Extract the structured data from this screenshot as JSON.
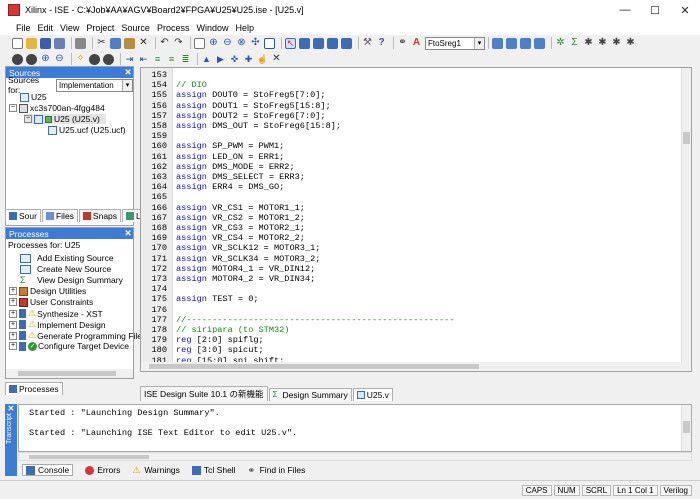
{
  "window": {
    "title": "Xilinx - ISE - C:¥Job¥AA¥AGV¥Board2¥FPGA¥U25¥U25.ise - [U25.v]",
    "minimize_glyph": "—",
    "maximize_glyph": "☐",
    "close_glyph": "✕"
  },
  "menu": [
    "File",
    "Edit",
    "View",
    "Project",
    "Source",
    "Process",
    "Window",
    "Help"
  ],
  "toolbar": {
    "search_value": "FtoSreg1",
    "row2_extra_icons": [
      "back-icon",
      "forward-icon",
      "zoom-in-icon",
      "zoom-out-icon",
      "help-icon"
    ]
  },
  "sources": {
    "header": "Sources",
    "close_glyph": "✕",
    "for_label": "Sources for:",
    "for_value": "Implementation",
    "tree": [
      {
        "label": "U25",
        "level": 0
      },
      {
        "label": "xc3s700an-4fgg484",
        "level": 0
      },
      {
        "label": "U25 (U25.v)",
        "level": 1
      },
      {
        "label": "U25.ucf (U25.ucf)",
        "level": 2
      }
    ],
    "tabs": [
      "Sources",
      "Files",
      "Snapshots",
      "Libraries"
    ],
    "tabs_visible": [
      "Sour",
      "Files",
      "Snaps",
      "Libra"
    ]
  },
  "processes": {
    "header": "Processes",
    "close_glyph": "✕",
    "for_label": "Processes for: U25",
    "items": [
      {
        "label": "Add Existing Source",
        "level": 1
      },
      {
        "label": "Create New Source",
        "level": 1
      },
      {
        "label": "View Design Summary",
        "level": 1
      },
      {
        "label": "Design Utilities",
        "level": 0
      },
      {
        "label": "User Constraints",
        "level": 0
      },
      {
        "label": "Synthesize - XST",
        "level": 0
      },
      {
        "label": "Implement Design",
        "level": 0
      },
      {
        "label": "Generate Programming File",
        "level": 0
      },
      {
        "label": "Configure Target Device",
        "level": 0
      }
    ],
    "tab": "Processes"
  },
  "editor": {
    "lines": [
      {
        "n": "153",
        "t": ""
      },
      {
        "n": "154",
        "t": "// DIO",
        "c": "cm"
      },
      {
        "n": "155",
        "t": "assign DOUT0 = StoFreg5[7:0];"
      },
      {
        "n": "156",
        "t": "assign DOUT1 = StoFreg5[15:8];"
      },
      {
        "n": "157",
        "t": "assign DOUT2 = StoFreg6[7:0];"
      },
      {
        "n": "158",
        "t": "assign DMS_OUT = StoFreg6[15:8];"
      },
      {
        "n": "159",
        "t": ""
      },
      {
        "n": "160",
        "t": "assign SP_PWM = PWM1;"
      },
      {
        "n": "161",
        "t": "assign LED_ON = ERR1;"
      },
      {
        "n": "162",
        "t": "assign DMS_MODE = ERR2;"
      },
      {
        "n": "163",
        "t": "assign DMS_SELECT = ERR3;"
      },
      {
        "n": "164",
        "t": "assign ERR4 = DMS_GO;"
      },
      {
        "n": "165",
        "t": ""
      },
      {
        "n": "166",
        "t": "assign VR_CS1 = MOTOR1_1;"
      },
      {
        "n": "167",
        "t": "assign VR_CS2 = MOTOR1_2;"
      },
      {
        "n": "168",
        "t": "assign VR_CS3 = MOTOR2_1;"
      },
      {
        "n": "169",
        "t": "assign VR_CS4 = MOTOR2_2;"
      },
      {
        "n": "170",
        "t": "assign VR_SCLK12 = MOTOR3_1;"
      },
      {
        "n": "171",
        "t": "assign VR_SCLK34 = MOTOR3_2;"
      },
      {
        "n": "172",
        "t": "assign MOTOR4_1 = VR_DIN12;"
      },
      {
        "n": "173",
        "t": "assign MOTOR4_2 = VR_DIN34;"
      },
      {
        "n": "174",
        "t": ""
      },
      {
        "n": "175",
        "t": "assign TEST = 0;"
      },
      {
        "n": "176",
        "t": ""
      },
      {
        "n": "177",
        "t": "//----------------------------------------------------",
        "c": "cm"
      },
      {
        "n": "178",
        "t": "// siripara (to STM32)",
        "c": "cm"
      },
      {
        "n": "179",
        "t": "reg [2:0] spiflg;"
      },
      {
        "n": "180",
        "t": "reg [3:0] spicut;"
      },
      {
        "n": "181",
        "t": "reg [15:0] spi_shift;"
      }
    ],
    "tabs": [
      "ISE Design Suite 10.1 の新機能",
      "Design Summary",
      "U25.v"
    ]
  },
  "console": {
    "lines": [
      "Started : \"Launching Design Summary\".",
      "Started : \"Launching ISE Text Editor to edit U25.v\"."
    ],
    "side_label": "Transcript",
    "close_glyph": "✕",
    "tabs": [
      "Console",
      "Errors",
      "Warnings",
      "Tcl Shell",
      "Find in Files"
    ]
  },
  "status": [
    "CAPS",
    "NUM",
    "SCRL",
    "Ln 1 Col 1",
    "Verilog"
  ]
}
